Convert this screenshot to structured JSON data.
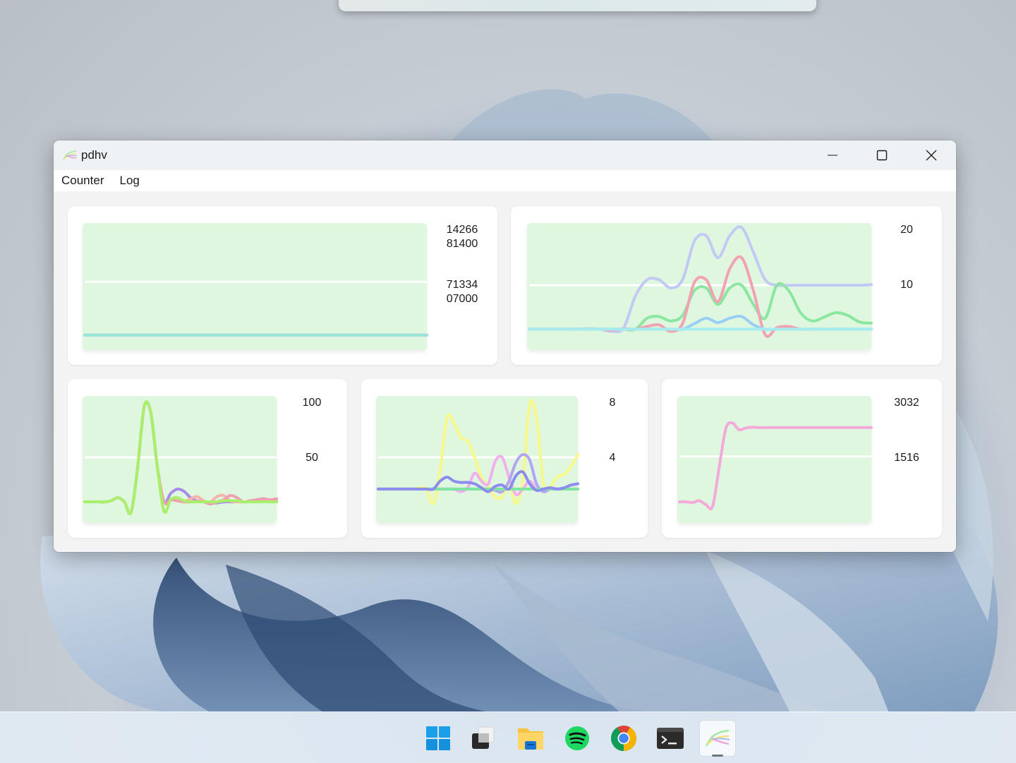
{
  "window": {
    "title": "pdhv",
    "controls": {
      "minimize": "minimize",
      "maximize": "maximize",
      "close": "close"
    }
  },
  "menu": [
    {
      "label": "Counter"
    },
    {
      "label": "Log"
    }
  ],
  "colors": {
    "plot_bg": "#dff7df",
    "midline": "#ffffff"
  },
  "chart_data": [
    {
      "type": "line",
      "id": "chart-1",
      "top_label": "14266\n81400",
      "mid_label": "71334\n07000",
      "tick_values": [
        1426681400,
        713407000
      ],
      "ylim": [
        -200000000,
        1500000000
      ],
      "series": [
        {
          "name": "series-teal",
          "color": "#8ee8bf",
          "values": [
            0,
            0,
            5,
            -20,
            -40,
            100,
            600,
            1050,
            1150,
            1080,
            980,
            1000,
            1010,
            1000,
            1000,
            1000,
            1000,
            1000,
            1000,
            1000,
            1000,
            1000,
            1000,
            1000,
            1000,
            1000,
            1000,
            1000,
            1000,
            1000,
            1000,
            1000,
            1000,
            1000,
            1000,
            1000,
            1000,
            1000,
            1000,
            1000
          ]
        },
        {
          "name": "series-pink-light",
          "color": "#fbc4e4",
          "values": [
            0,
            0,
            0,
            0,
            0,
            0,
            -30,
            100,
            500,
            800,
            860,
            850,
            850,
            850,
            850,
            850,
            850,
            850,
            850,
            850,
            850,
            850,
            850,
            850,
            850,
            850,
            850,
            850,
            850,
            850,
            850,
            850,
            850,
            850,
            850,
            850,
            850,
            850,
            850,
            850
          ]
        },
        {
          "name": "series-magenta",
          "color": "#f19ff0",
          "values": [
            0,
            0,
            0,
            0,
            0,
            0,
            200,
            700,
            600,
            200,
            -50,
            0,
            20,
            0,
            0,
            0,
            0,
            0,
            0,
            0,
            0,
            0,
            0,
            0,
            0,
            0,
            0,
            0,
            0,
            0,
            0,
            0,
            0,
            0,
            0,
            0,
            0,
            0,
            0,
            0
          ]
        },
        {
          "name": "series-cyan",
          "color": "#96e6d6",
          "values": [
            0,
            0,
            5,
            -20,
            -40,
            -10,
            10,
            30,
            30,
            30,
            30,
            30,
            30,
            30,
            30,
            30,
            30,
            30,
            30,
            30,
            30,
            30,
            30,
            30,
            30,
            30,
            30,
            30,
            30,
            30,
            30,
            30,
            30,
            30,
            30,
            30,
            30,
            30,
            30,
            30
          ]
        }
      ]
    },
    {
      "type": "line",
      "id": "chart-2",
      "top_label": "20",
      "mid_label": "10",
      "tick_values": [
        20,
        10
      ],
      "ylim": [
        -1.8,
        21.3
      ],
      "series": [
        {
          "name": "series-periwinkle",
          "color": "#c3c9f5",
          "values": [
            2,
            2,
            2,
            2,
            2,
            2.1,
            2,
            1.6,
            2.2,
            8,
            11,
            11,
            9.5,
            11,
            18,
            19,
            15,
            19,
            20.5,
            16,
            11,
            10,
            10,
            10,
            10,
            10,
            10,
            10,
            10,
            10.1
          ]
        },
        {
          "name": "series-green",
          "color": "#8be6a0",
          "values": [
            2,
            2,
            2,
            2,
            2,
            2,
            2,
            2,
            2,
            2,
            4,
            4.3,
            3.5,
            4.5,
            9,
            9.5,
            6.5,
            9.5,
            10,
            6.5,
            4,
            10,
            9,
            5,
            3.5,
            4.2,
            5,
            4.5,
            3.3,
            3.1
          ]
        },
        {
          "name": "series-red",
          "color": "#f2a2b2",
          "values": [
            2,
            2,
            2,
            2,
            2,
            2,
            2,
            1.8,
            2.1,
            2,
            2.5,
            2.8,
            1.6,
            3,
            10.5,
            11,
            7,
            13,
            15,
            9,
            1,
            2.3,
            2.5,
            2,
            2,
            2,
            2,
            2,
            2,
            2
          ]
        },
        {
          "name": "series-blue",
          "color": "#98cff5",
          "values": [
            2,
            2,
            2,
            2,
            2,
            2,
            2,
            2,
            2,
            2,
            2,
            2,
            2,
            2,
            3,
            4,
            3.2,
            4,
            4.3,
            2.8,
            2,
            2,
            2,
            2,
            2,
            2,
            2,
            2,
            2,
            2
          ]
        },
        {
          "name": "series-aqua",
          "color": "#a6ecef",
          "values": [
            2,
            2,
            2,
            2,
            2,
            2,
            2,
            2,
            2,
            2,
            2,
            2,
            2,
            2,
            2,
            2,
            2,
            2,
            2,
            2,
            2,
            2,
            2,
            2,
            2,
            2,
            2,
            2,
            2,
            2
          ]
        }
      ]
    },
    {
      "type": "line",
      "id": "chart-3",
      "top_label": "100",
      "mid_label": "50",
      "tick_values": [
        100,
        50
      ],
      "ylim": [
        -12,
        108
      ],
      "series": [
        {
          "name": "series-purple",
          "color": "#a889ec",
          "values": [
            8,
            8,
            8,
            8,
            9,
            12,
            8,
            -2,
            40,
            98,
            92,
            40,
            8,
            16,
            20,
            18,
            12,
            9,
            8,
            7,
            7,
            8,
            8,
            8,
            8,
            8,
            8,
            8,
            8,
            8
          ]
        },
        {
          "name": "series-salmon",
          "color": "#f5b5a8",
          "values": [
            8,
            8,
            8,
            8,
            9,
            12,
            8,
            -2,
            40,
            98,
            92,
            40,
            8,
            10,
            9,
            8,
            11,
            13,
            9,
            8,
            13,
            14,
            9,
            8,
            8,
            8,
            9,
            10,
            9,
            9
          ]
        },
        {
          "name": "series-rose",
          "color": "#ef9fb1",
          "values": [
            8,
            8,
            8,
            8,
            9,
            12,
            8,
            -2,
            40,
            98,
            92,
            40,
            8,
            10,
            9,
            8,
            8,
            9,
            8,
            6,
            8,
            10,
            14,
            12,
            8,
            9,
            10,
            11,
            10,
            11
          ]
        },
        {
          "name": "series-lime",
          "color": "#a8f06a",
          "values": [
            8,
            8,
            8,
            8,
            9,
            12,
            8,
            -2,
            40,
            98,
            92,
            40,
            -1,
            10,
            12,
            9,
            8,
            8,
            8,
            8,
            8,
            9,
            9,
            9,
            8,
            8,
            8,
            8,
            8,
            8
          ]
        }
      ]
    },
    {
      "type": "line",
      "id": "chart-4",
      "top_label": "8",
      "mid_label": "4",
      "tick_values": [
        8,
        4
      ],
      "ylim": [
        -0.97,
        8.64
      ],
      "series": [
        {
          "name": "series-yellow",
          "color": "#f8f88a",
          "values": [
            1.6,
            1.6,
            1.6,
            1.6,
            1.6,
            1.6,
            1.7,
            1.6,
            0.5,
            3,
            7,
            6.6,
            5.5,
            5.2,
            4,
            2.5,
            1.8,
            1,
            1,
            2,
            0.5,
            2.2,
            8,
            7,
            2,
            1.8,
            2.5,
            2.7,
            3.3,
            4.2
          ]
        },
        {
          "name": "series-violet-light",
          "color": "#f0b0ee",
          "values": [
            1.6,
            1.6,
            1.6,
            1.6,
            1.6,
            1.6,
            1.6,
            1.6,
            1.6,
            1.6,
            1.6,
            1.6,
            1.4,
            1.7,
            2.8,
            2.2,
            2.0,
            3.7,
            4,
            2.5,
            1.2,
            1.6,
            2.2,
            1.6,
            1.5,
            1.6,
            1.6,
            1.6,
            1.6,
            1.6
          ]
        },
        {
          "name": "series-lavender",
          "color": "#b3a6f0",
          "values": [
            1.6,
            1.6,
            1.6,
            1.6,
            1.6,
            1.6,
            1.6,
            1.6,
            1.6,
            1.6,
            1.6,
            1.6,
            1.6,
            1.6,
            1.6,
            1.6,
            1.6,
            1.5,
            1.4,
            2.2,
            3.6,
            4.2,
            3.8,
            2.0,
            1.4,
            1.6,
            1.6,
            1.6,
            1.6,
            1.6
          ]
        },
        {
          "name": "series-green",
          "color": "#7fe6a0",
          "values": [
            1.6,
            1.6,
            1.6,
            1.6,
            1.6,
            1.6,
            1.6,
            1.6,
            1.6,
            1.6,
            1.6,
            1.6,
            1.6,
            1.6,
            1.6,
            1.6,
            1.6,
            1.6,
            1.6,
            1.6,
            1.6,
            1.6,
            1.6,
            1.6,
            1.6,
            1.6,
            1.6,
            1.6,
            1.6,
            1.6
          ]
        },
        {
          "name": "series-indigo",
          "color": "#8b8cee",
          "values": [
            1.6,
            1.6,
            1.6,
            1.6,
            1.6,
            1.6,
            1.6,
            1.6,
            1.6,
            2.2,
            2.5,
            2.2,
            2.1,
            2.1,
            2.0,
            1.7,
            1.4,
            1.8,
            1.9,
            1.6,
            2.6,
            2.9,
            2.0,
            1.5,
            1.6,
            1.7,
            1.6,
            1.7,
            1.9,
            2.0
          ]
        }
      ]
    },
    {
      "type": "line",
      "id": "chart-5",
      "top_label": "3032",
      "mid_label": "1516",
      "tick_values": [
        3032,
        1516
      ],
      "ylim": [
        -370,
        3226
      ],
      "series": [
        {
          "name": "series-pink",
          "color": "#f3a9d9",
          "values": [
            230,
            230,
            210,
            260,
            150,
            100,
            1200,
            2300,
            2460,
            2270,
            2320,
            2340,
            2330,
            2330,
            2330,
            2330,
            2330,
            2330,
            2330,
            2330,
            2330,
            2330,
            2330,
            2330,
            2330,
            2330,
            2330,
            2330,
            2330,
            2330
          ]
        }
      ]
    }
  ],
  "taskbar": {
    "items": [
      {
        "name": "start"
      },
      {
        "name": "task-view"
      },
      {
        "name": "file-explorer"
      },
      {
        "name": "spotify"
      },
      {
        "name": "chrome"
      },
      {
        "name": "terminal"
      },
      {
        "name": "pdhv",
        "active": true
      }
    ]
  }
}
